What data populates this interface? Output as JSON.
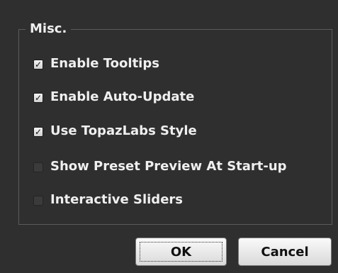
{
  "group": {
    "title": "Misc."
  },
  "options": [
    {
      "label": "Enable Tooltips",
      "checked": true
    },
    {
      "label": "Enable Auto-Update",
      "checked": true
    },
    {
      "label": "Use TopazLabs Style",
      "checked": true
    },
    {
      "label": "Show Preset Preview At Start-up",
      "checked": false
    },
    {
      "label": "Interactive Sliders",
      "checked": false
    }
  ],
  "buttons": {
    "ok_label": "OK",
    "cancel_label": "Cancel"
  }
}
